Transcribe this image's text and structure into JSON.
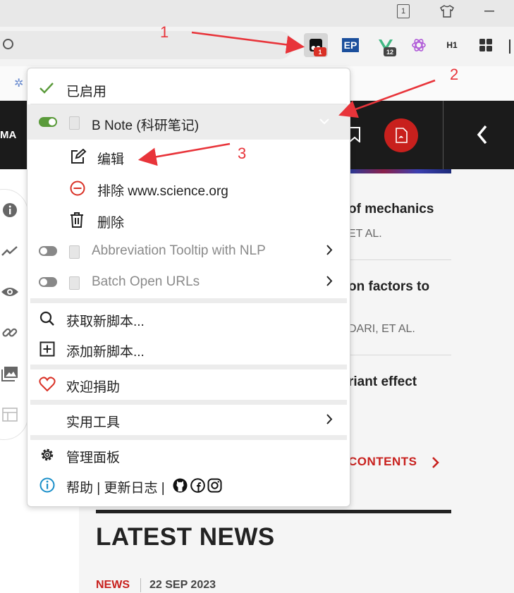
{
  "titlebar": {
    "tab_count": "1"
  },
  "extensions": {
    "tampermonkey_badge": "1",
    "vue_badge": "12",
    "ep_label": "EP",
    "h1_label": "H1"
  },
  "page": {
    "nav_fragment": "MA",
    "articles": [
      {
        "title": "of mechanics",
        "authors": "ET AL."
      },
      {
        "title": "on factors to",
        "authors": "DARI, ET AL."
      },
      {
        "title": "riant effect",
        "authors": ""
      }
    ],
    "contents_link": "CONTENTS",
    "latest_news_heading": "LATEST NEWS",
    "news_tag": "NEWS",
    "news_date": "22 SEP 2023"
  },
  "menu": {
    "enabled_label": "已启用",
    "scripts": [
      {
        "name": "B Note (科研笔记)",
        "enabled": true
      },
      {
        "name": "Abbreviation Tooltip with NLP",
        "enabled": false
      },
      {
        "name": "Batch Open URLs",
        "enabled": false
      }
    ],
    "submenu": {
      "edit": "编辑",
      "exclude": "排除 www.science.org",
      "delete": "删除"
    },
    "get_scripts": "获取新脚本...",
    "add_script": "添加新脚本...",
    "donate": "欢迎捐助",
    "utilities": "实用工具",
    "dashboard": "管理面板",
    "help_text": "帮助 | 更新日志 |"
  },
  "annotations": [
    "1",
    "2",
    "3"
  ],
  "colors": {
    "accent_red": "#c8201d",
    "toggle_on": "#5a9a3a",
    "toggle_off": "#888888",
    "annotation": "#e8343a"
  }
}
